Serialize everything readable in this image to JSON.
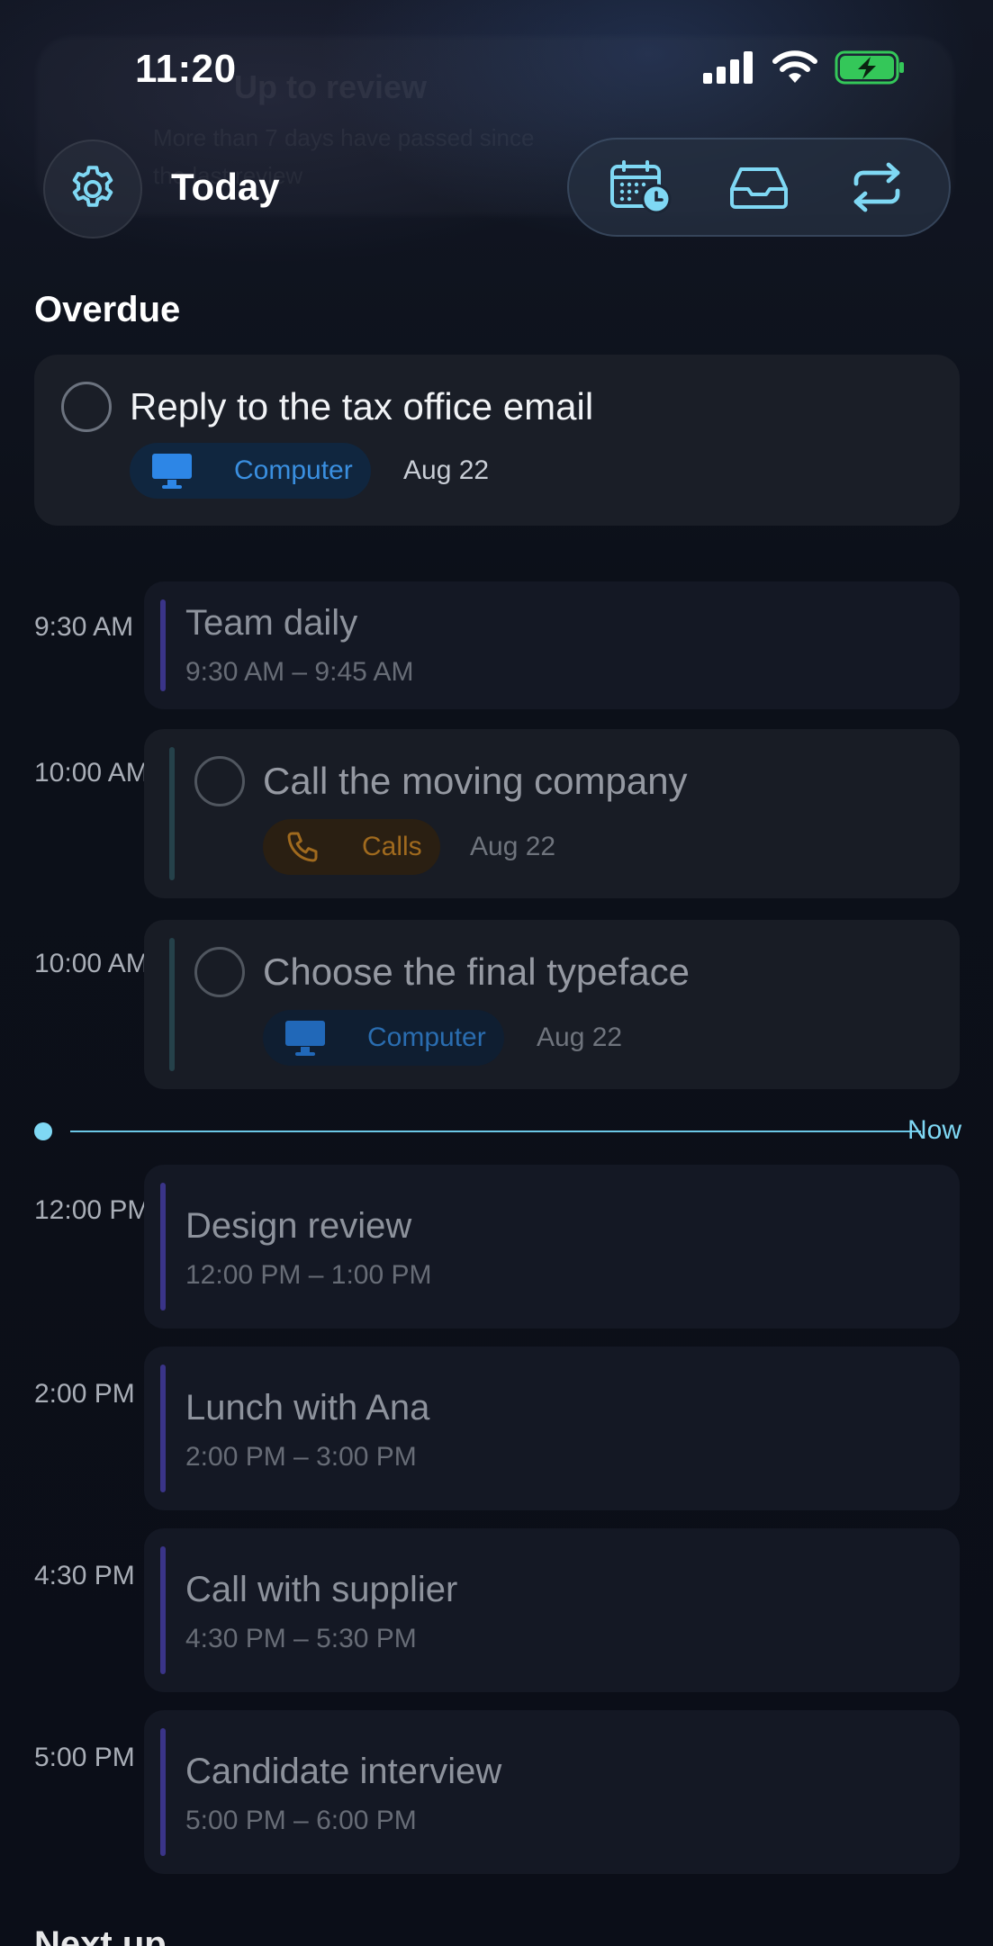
{
  "status_bar": {
    "time": "11:20"
  },
  "ghost_notification": {
    "title": "Up to review",
    "line1": "More than 7 days have passed since",
    "line2": "the last review"
  },
  "header": {
    "title": "Today"
  },
  "overdue": {
    "section_title": "Overdue",
    "task": {
      "title": "Reply to the tax office email",
      "context": "Computer",
      "context_icon": "monitor-icon",
      "date": "Aug 22"
    }
  },
  "timeline": {
    "events": [
      {
        "time": "9:30 AM",
        "title": "Team daily",
        "range": "9:30 AM – 9:45 AM"
      },
      {
        "time": "12:00 PM",
        "title": "Design review",
        "range": "12:00 PM – 1:00 PM"
      },
      {
        "time": "2:00 PM",
        "title": "Lunch with Ana",
        "range": "2:00 PM – 3:00 PM"
      },
      {
        "time": "4:30 PM",
        "title": "Call with supplier",
        "range": "4:30 PM – 5:30 PM"
      },
      {
        "time": "5:00 PM",
        "title": "Candidate interview",
        "range": "5:00 PM – 6:00 PM"
      }
    ],
    "tasks": [
      {
        "time": "10:00 AM",
        "title": "Call the moving company",
        "context": "Calls",
        "context_icon": "phone-icon",
        "date": "Aug 22"
      },
      {
        "time": "10:00 AM",
        "title": "Choose the final typeface",
        "context": "Computer",
        "context_icon": "monitor-icon",
        "date": "Aug 22"
      }
    ],
    "now_label": "Now"
  },
  "next_section": {
    "title": "Next up ..."
  },
  "colors": {
    "accent_cyan": "#7fd8f4",
    "event_bar": "#3a3488",
    "chip_blue": "#3a8fe0",
    "chip_orange": "#a06a1e",
    "battery_green": "#34c759"
  }
}
